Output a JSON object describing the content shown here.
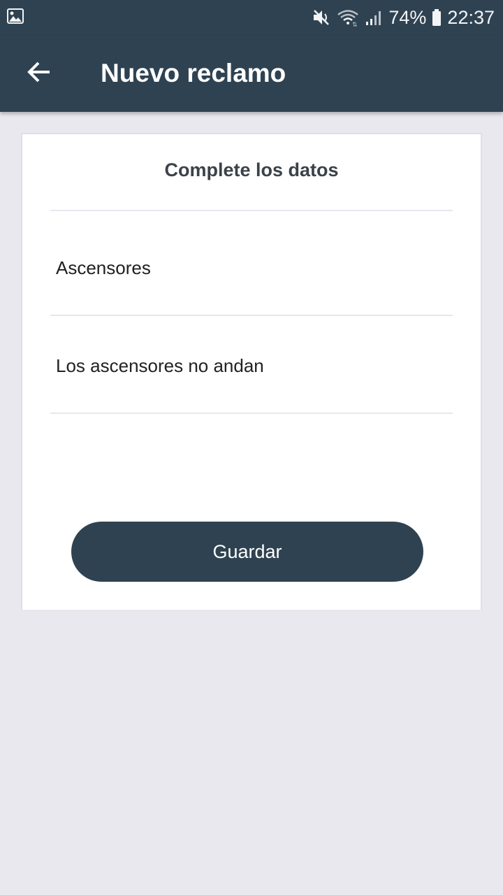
{
  "status_bar": {
    "battery": "74%",
    "time": "22:37",
    "icons": [
      "image-notification-icon",
      "mute-icon",
      "wifi-icon",
      "signal-icon",
      "battery-icon"
    ]
  },
  "app_bar": {
    "title": "Nuevo reclamo",
    "back_icon": "arrow-left-icon"
  },
  "form": {
    "heading": "Complete los datos",
    "category_value": "Ascensores",
    "description_value": "Los ascensores no andan",
    "save_label": "Guardar"
  },
  "colors": {
    "primary": "#2f4251",
    "background": "#e9e8ee",
    "card": "#ffffff"
  }
}
